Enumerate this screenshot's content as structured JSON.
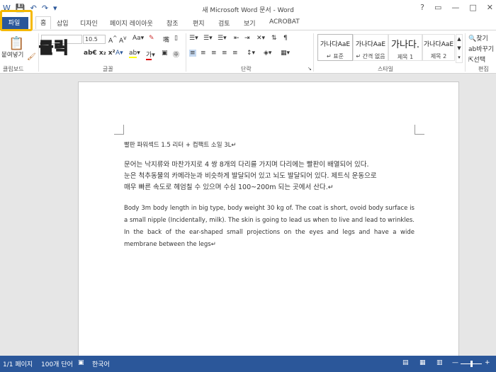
{
  "window": {
    "title": "새 Microsoft Word 문서 - Word",
    "controls": [
      "?",
      "□",
      "—",
      "□",
      "✕"
    ]
  },
  "qat": [
    "word-icon",
    "save-icon",
    "undo-icon",
    "redo-icon",
    "customize-icon"
  ],
  "tabs": [
    "파일",
    "홈",
    "삽입",
    "디자인",
    "페이지 레이아웃",
    "참조",
    "편지",
    "검토",
    "보기",
    "ACROBAT"
  ],
  "annotation": {
    "label": "클릭",
    "color": "#f9d400"
  },
  "ribbon": {
    "clipboard": {
      "paste_label": "붙여넣기",
      "group": "클립보드"
    },
    "font": {
      "name": "",
      "size": "10.5",
      "group": "글꼴"
    },
    "paragraph": {
      "group": "단락"
    },
    "styles": {
      "group": "스타일",
      "items": [
        {
          "preview": "가나다AaE",
          "name": "↵ 표준"
        },
        {
          "preview": "가나다AaE",
          "name": "↵ 간격 없음"
        },
        {
          "preview": "가나다.",
          "name": "제목 1"
        },
        {
          "preview": "가나다AaE",
          "name": "제목 2"
        }
      ]
    },
    "editing": {
      "find": "찾기",
      "replace": "바꾸기",
      "select": "선택",
      "group": "편집"
    }
  },
  "document": {
    "title_line": "빨판 파워섹드 1.5 리터 + 컴팩트 소일 3L↵",
    "para_ko_1": "문어는 낙지류와 마찬가지로 4 쌍 8개의 다리를 가지며 다리에는 빨판이 배열되어 있다.",
    "para_ko_2": "눈은 척추동물의 카메라눈과 비슷하게 발달되어 있고 뇌도 발달되어 있다. 제트식 운동으로",
    "para_ko_3": "매우 빠른 속도로 헤엄칠 수 있으며 수심 100~200m 되는 곳에서 산다.↵",
    "para_en": "Body 3m body length in big type, body weight 30 kg of. The coat is short, ovoid body surface is a small nipple (Incidentally, milk). The skin is going to lead us when to live and lead to wrinkles. In the back of the ear-shaped small projections on the eyes and legs and have a wide membrane between the legs↵"
  },
  "status": {
    "page": "1/1 페이지",
    "words": "100개 단어",
    "lang": "한국어"
  },
  "colors": {
    "accent": "#2b579a",
    "highlight": "#f5b800"
  }
}
